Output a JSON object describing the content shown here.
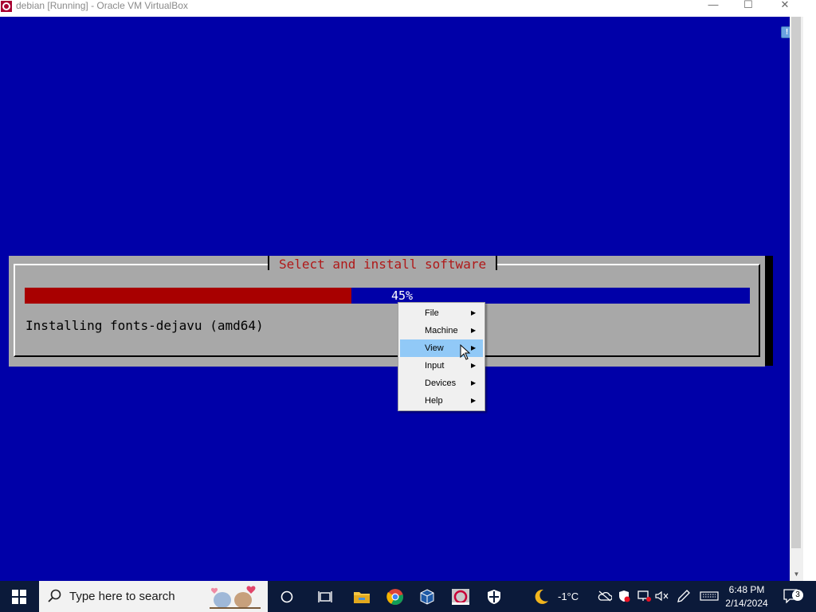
{
  "window": {
    "title": "debian [Running] - Oracle VM VirtualBox",
    "controls": {
      "minimize": "—",
      "maximize": "☐",
      "close": "✕"
    }
  },
  "installer": {
    "dialog_title": "Select and install software",
    "progress_fraction": 0.45,
    "progress_label": "45%",
    "status": "Installing fonts-dejavu (amd64)"
  },
  "context_menu": {
    "items": [
      {
        "label": "File",
        "icon": "submenu-arrow-icon"
      },
      {
        "label": "Machine",
        "icon": "submenu-arrow-icon"
      },
      {
        "label": "View",
        "icon": "submenu-arrow-icon",
        "highlighted": true
      },
      {
        "label": "Input",
        "icon": "submenu-arrow-icon"
      },
      {
        "label": "Devices",
        "icon": "submenu-arrow-icon"
      },
      {
        "label": "Help",
        "icon": "submenu-arrow-icon"
      }
    ]
  },
  "taskbar": {
    "search_placeholder": "Type here to search",
    "weather": "-1°C",
    "time": "6:48 PM",
    "date": "2/14/2024",
    "notification_count": "3",
    "pinned": [
      "start-icon",
      "cortana-icon",
      "task-view-icon",
      "file-explorer-icon",
      "chrome-icon",
      "virtualbox-icon",
      "debian-icon",
      "security-icon"
    ]
  },
  "colors": {
    "vm_background": "#0000a8",
    "dialog_background": "#a8a8a8",
    "dialog_title": "#b01818",
    "progress_fill": "#a80000",
    "menu_highlight": "#91c9f7",
    "taskbar": "#0b1a3a"
  }
}
